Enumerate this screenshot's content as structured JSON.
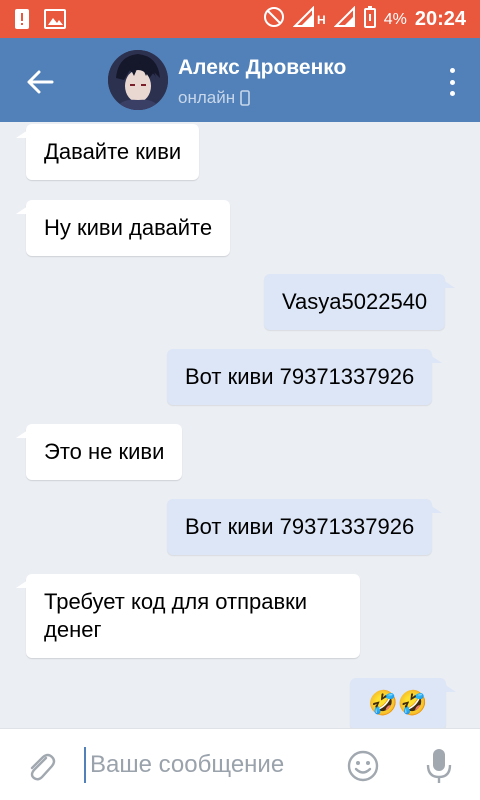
{
  "status_bar": {
    "battery_percent": "4%",
    "time": "20:24",
    "network": "H",
    "icons": [
      "alert-icon",
      "image-icon",
      "do-not-disturb-icon",
      "signal-icon",
      "signal-icon",
      "battery-icon"
    ]
  },
  "header": {
    "contact_name": "Алекс Дровенко",
    "status": "онлайн",
    "status_icon": "mobile-phone-icon"
  },
  "messages": [
    {
      "direction": "in",
      "text": "Давайте киви"
    },
    {
      "direction": "in",
      "text": "Ну киви давайте"
    },
    {
      "direction": "out",
      "text": "Vasya5022540"
    },
    {
      "direction": "out",
      "text": "Вот киви 79371337926"
    },
    {
      "direction": "in",
      "text": "Это не киви"
    },
    {
      "direction": "out",
      "text": "Вот киви 79371337926"
    },
    {
      "direction": "in",
      "text": "Требует код для отправки денег"
    },
    {
      "direction": "out",
      "text": "🤣🤣"
    }
  ],
  "composer": {
    "placeholder": "Ваше сообщение",
    "value": ""
  },
  "colors": {
    "status_bar": "#e9573d",
    "header": "#5181b8",
    "background": "#ebeef3",
    "incoming_bubble": "#ffffff",
    "outgoing_bubble": "#dce6f6"
  }
}
